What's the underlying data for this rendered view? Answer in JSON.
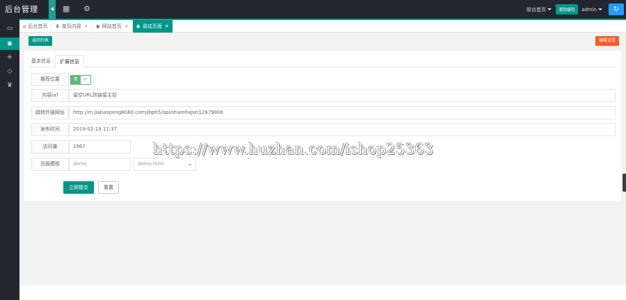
{
  "app": {
    "title": "后台管理"
  },
  "topbar": {
    "home_link": "前台首页",
    "clear_cache": "清除缓存",
    "user": "admin",
    "refresh_icon": "refresh-icon"
  },
  "sidebar": {
    "icons": [
      "layout-icon",
      "target-icon",
      "dashboard-icon",
      "diamond-icon",
      "crown-icon"
    ]
  },
  "tabs": [
    {
      "label": "后台首页",
      "icon": "home-icon",
      "closable": false,
      "active": false
    },
    {
      "label": "单页内容",
      "icon": "crown-icon",
      "closable": true,
      "active": false
    },
    {
      "label": "网站首页",
      "icon": "target-icon",
      "closable": true,
      "active": false
    },
    {
      "label": "调试页面",
      "icon": "target-icon",
      "closable": true,
      "active": true
    }
  ],
  "actions": {
    "return": "返回列表",
    "edit": "编辑设置"
  },
  "form_tabs": {
    "basic": "基本信息",
    "extended": "扩展信息"
  },
  "form": {
    "recommend": {
      "label": "推荐位置",
      "value": "否"
    },
    "url": {
      "label": "内容url",
      "value": "留空URL则链接主控"
    },
    "jump": {
      "label": "跳转外链网址",
      "value": "http://m.jiabaopeng8080.com/jbph5/api/shareFaper12879806"
    },
    "time": {
      "label": "发布时间",
      "value": "2019-02-19 11:37"
    },
    "views": {
      "label": "访问量",
      "value": "1967"
    },
    "template": {
      "label": "页面模板",
      "value": "demo",
      "select": "demo.html"
    }
  },
  "buttons": {
    "submit": "立即提交",
    "reset": "重置"
  },
  "watermark": "https://www.huzhan.com/ishop25363"
}
